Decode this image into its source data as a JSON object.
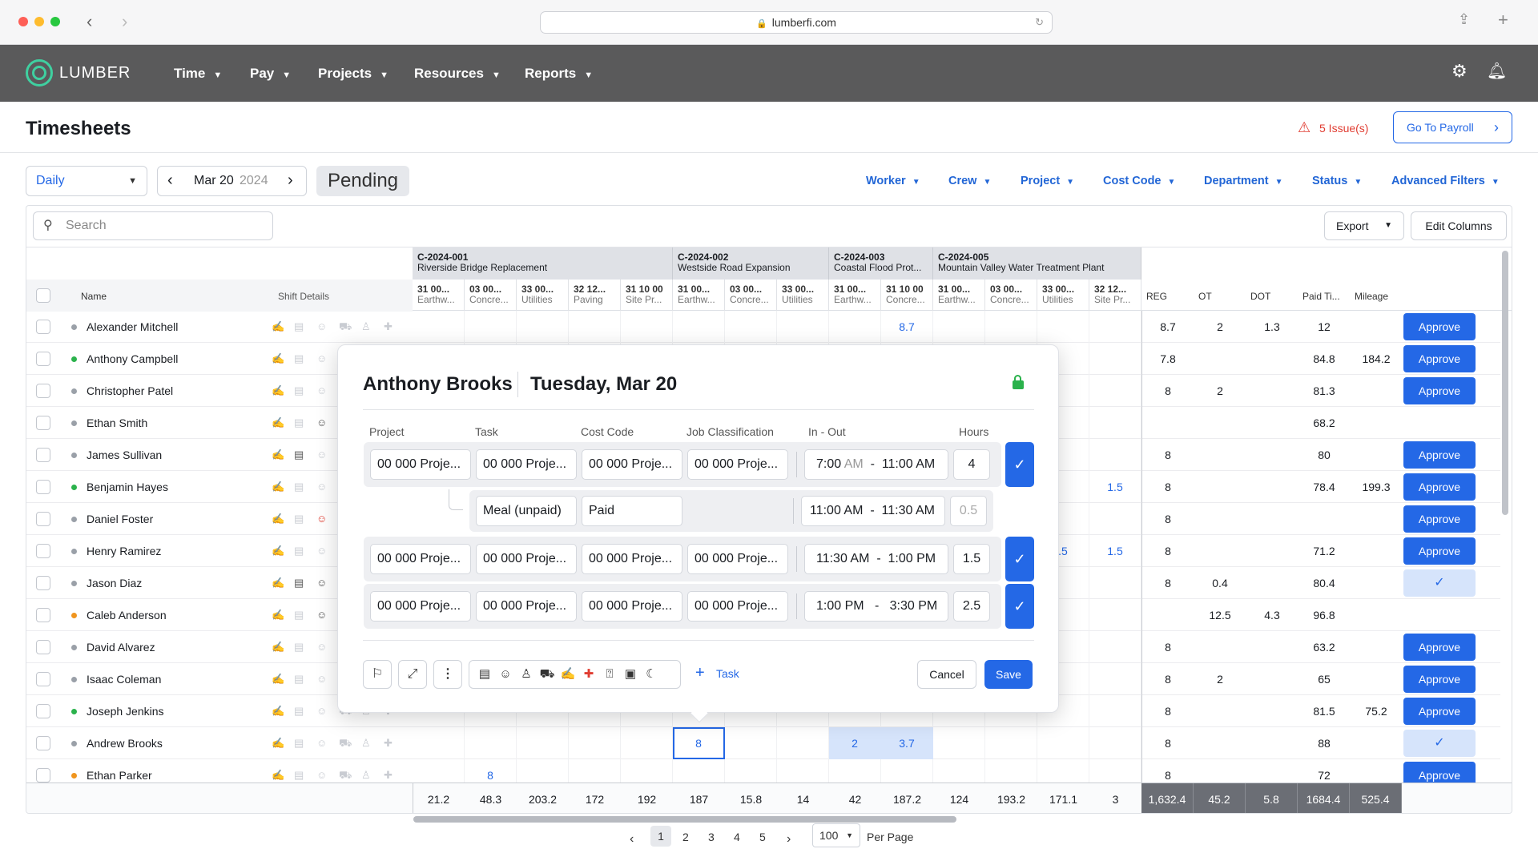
{
  "browser": {
    "url": "lumberfi.com"
  },
  "brand": {
    "logo_text": "LUMBER",
    "accent": "#2468e6",
    "nav_bg": "#5a5a5b"
  },
  "nav": {
    "items": [
      {
        "label": "Time"
      },
      {
        "label": "Pay"
      },
      {
        "label": "Projects"
      },
      {
        "label": "Resources"
      },
      {
        "label": "Reports"
      }
    ]
  },
  "page": {
    "title": "Timesheets",
    "issues": "5 Issue(s)",
    "goto_payroll": "Go To Payroll"
  },
  "toolbar": {
    "view": "Daily",
    "date": "Mar 20",
    "year": "2024",
    "status_chip": "Pending",
    "filters": [
      "Worker",
      "Crew",
      "Project",
      "Cost Code",
      "Department",
      "Status",
      "Advanced Filters"
    ],
    "search_placeholder": "Search",
    "export": "Export",
    "edit_columns": "Edit Columns"
  },
  "grid": {
    "col_name": "Name",
    "col_shift": "Shift Details",
    "projects": [
      {
        "code": "C-2024-001",
        "name": "Riverside Bridge Replacement"
      },
      {
        "code": "C-2024-002",
        "name": "Westside Road Expansion"
      },
      {
        "code": "C-2024-003",
        "name": "Coastal Flood Prot..."
      },
      {
        "code": "C-2024-005",
        "name": "Mountain Valley Water Treatment Plant"
      }
    ],
    "cost_codes": [
      {
        "code": "31 00...",
        "name": "Earthw..."
      },
      {
        "code": "03 00...",
        "name": "Concre..."
      },
      {
        "code": "33 00...",
        "name": "Utilities"
      },
      {
        "code": "32 12...",
        "name": "Paving"
      },
      {
        "code": "31 10 00",
        "name": "Site Pr..."
      },
      {
        "code": "31 00...",
        "name": "Earthw..."
      },
      {
        "code": "03 00...",
        "name": "Concre..."
      },
      {
        "code": "33 00...",
        "name": "Utilities"
      },
      {
        "code": "31 00...",
        "name": "Earthw..."
      },
      {
        "code": "31 10 00",
        "name": "Concre..."
      },
      {
        "code": "31 00...",
        "name": "Earthw..."
      },
      {
        "code": "03 00...",
        "name": "Concre..."
      },
      {
        "code": "33 00...",
        "name": "Utilities"
      },
      {
        "code": "32 12...",
        "name": "Site Pr..."
      }
    ],
    "summary_cols": [
      "REG",
      "OT",
      "DOT",
      "Paid Ti...",
      "Mileage"
    ],
    "approve_label": "Approve",
    "rows": [
      {
        "name": "Alexander Mitchell",
        "dot": "#9aa0a8",
        "reg": "8.7",
        "ot": "2",
        "dot_h": "1.3",
        "paid": "12",
        "mileage": "",
        "state": "approve"
      },
      {
        "name": "Anthony Campbell",
        "dot": "#2bb24c",
        "reg": "7.8",
        "ot": "",
        "dot_h": "",
        "paid": "84.8",
        "mileage": "184.2",
        "state": "approve"
      },
      {
        "name": "Christopher Patel",
        "dot": "#9aa0a8",
        "reg": "8",
        "ot": "2",
        "dot_h": "",
        "paid": "81.3",
        "mileage": "",
        "state": "approve"
      },
      {
        "name": "Ethan Smith",
        "dot": "#9aa0a8",
        "reg": "",
        "ot": "",
        "dot_h": "",
        "paid": "68.2",
        "mileage": "",
        "state": "none"
      },
      {
        "name": "James Sullivan",
        "dot": "#9aa0a8",
        "reg": "8",
        "ot": "",
        "dot_h": "",
        "paid": "80",
        "mileage": "",
        "state": "approve"
      },
      {
        "name": "Benjamin Hayes",
        "dot": "#2bb24c",
        "reg": "8",
        "ot": "",
        "dot_h": "",
        "paid": "78.4",
        "mileage": "199.3",
        "state": "approve"
      },
      {
        "name": "Daniel Foster",
        "dot": "#9aa0a8",
        "reg": "8",
        "ot": "",
        "dot_h": "",
        "paid": "",
        "mileage": "",
        "state": "approve"
      },
      {
        "name": "Henry Ramirez",
        "dot": "#9aa0a8",
        "reg": "8",
        "ot": "",
        "dot_h": "",
        "paid": "71.2",
        "mileage": "",
        "state": "approve"
      },
      {
        "name": "Jason Diaz",
        "dot": "#9aa0a8",
        "reg": "8",
        "ot": "0.4",
        "dot_h": "",
        "paid": "80.4",
        "mileage": "",
        "state": "approved"
      },
      {
        "name": "Caleb Anderson",
        "dot": "#f0951e",
        "reg": "",
        "ot": "12.5",
        "dot_h": "4.3",
        "paid": "96.8",
        "mileage": "",
        "state": "none"
      },
      {
        "name": "David Alvarez",
        "dot": "#9aa0a8",
        "reg": "8",
        "ot": "",
        "dot_h": "",
        "paid": "63.2",
        "mileage": "",
        "state": "approve"
      },
      {
        "name": "Isaac Coleman",
        "dot": "#9aa0a8",
        "reg": "8",
        "ot": "2",
        "dot_h": "",
        "paid": "65",
        "mileage": "",
        "state": "approve"
      },
      {
        "name": "Joseph Jenkins",
        "dot": "#2bb24c",
        "reg": "8",
        "ot": "",
        "dot_h": "",
        "paid": "81.5",
        "mileage": "75.2",
        "state": "approve"
      },
      {
        "name": "Andrew Brooks",
        "dot": "#9aa0a8",
        "reg": "8",
        "ot": "",
        "dot_h": "",
        "paid": "88",
        "mileage": "",
        "state": "approved"
      },
      {
        "name": "Ethan Parker",
        "dot": "#f0951e",
        "reg": "8",
        "ot": "",
        "dot_h": "",
        "paid": "72",
        "mileage": "",
        "state": "approve"
      }
    ],
    "cell_values": {
      "alexander_cc10": "8.7",
      "benjamin_cc14": "1.5",
      "henry_cc13": ".5",
      "henry_cc14": "1.5",
      "andrew_cc6": "8",
      "andrew_cc9": "2",
      "andrew_cc10": "3.7",
      "ethan_parker_cc2": "8"
    },
    "footer_totals": [
      "21.2",
      "48.3",
      "203.2",
      "172",
      "192",
      "187",
      "15.8",
      "14",
      "42",
      "187.2",
      "124",
      "193.2",
      "171.1",
      "3"
    ],
    "footer_summary": [
      "1,632.4",
      "45.2",
      "5.8",
      "1684.4",
      "525.4"
    ]
  },
  "popover": {
    "worker": "Anthony Brooks",
    "date": "Tuesday, Mar 20",
    "headers": {
      "project": "Project",
      "task": "Task",
      "cost_code": "Cost Code",
      "job_class": "Job Classification",
      "in_out": "In - Out",
      "hours": "Hours"
    },
    "entries": [
      {
        "project": "00 000 Proje...",
        "task": "00 000 Proje...",
        "cost_code": "00 000 Proje...",
        "job_class": "00 000 Proje...",
        "in": "7:00",
        "in_ampm": "AM",
        "sep": "-",
        "out": "11:00 AM",
        "hours": "4"
      },
      {
        "project": "00 000 Proje...",
        "task": "00 000 Proje...",
        "cost_code": "00 000 Proje...",
        "job_class": "00 000 Proje...",
        "in": "11:30 AM",
        "sep": "-",
        "out": "1:00 PM",
        "hours": "1.5"
      },
      {
        "project": "00 000 Proje...",
        "task": "00 000 Proje...",
        "cost_code": "00 000 Proje...",
        "job_class": "00 000 Proje...",
        "in": "1:00 PM",
        "sep": "-",
        "out": "3:30 PM",
        "hours": "2.5"
      }
    ],
    "break": {
      "type": "Meal (unpaid)",
      "paid": "Paid",
      "in": "11:00 AM",
      "sep": "-",
      "out": "11:30 AM",
      "hours": "0.5"
    },
    "add_task": "Task",
    "cancel": "Cancel",
    "save": "Save"
  },
  "pagination": {
    "pages": [
      "1",
      "2",
      "3",
      "4",
      "5"
    ],
    "per_page_value": "100",
    "per_page_label": "Per Page"
  }
}
